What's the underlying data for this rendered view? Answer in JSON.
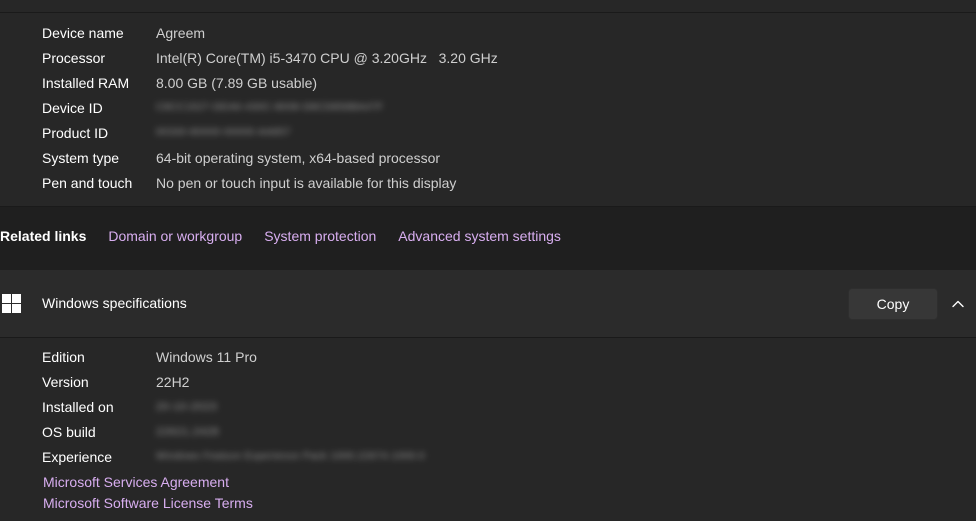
{
  "device_specs": {
    "rows": [
      {
        "key": "Device name",
        "value": "Agreem"
      },
      {
        "key": "Processor",
        "value": "Intel(R) Core(TM) i5-3470 CPU @ 3.20GHz   3.20 GHz"
      },
      {
        "key": "Installed RAM",
        "value": "8.00 GB (7.89 GB usable)"
      },
      {
        "key": "Device ID",
        "value": "C8CC1527-DEA6-430C-8008-D8CD858BA47F"
      },
      {
        "key": "Product ID",
        "value": "00330-80000-00000-AA857"
      },
      {
        "key": "System type",
        "value": "64-bit operating system, x64-based processor"
      },
      {
        "key": "Pen and touch",
        "value": "No pen or touch input is available for this display"
      }
    ]
  },
  "related_links": {
    "label": "Related links",
    "links": [
      "Domain or workgroup",
      "System protection",
      "Advanced system settings"
    ]
  },
  "windows_specs": {
    "title": "Windows specifications",
    "copy_label": "Copy",
    "rows": [
      {
        "key": "Edition",
        "value": "Windows 11 Pro"
      },
      {
        "key": "Version",
        "value": "22H2"
      },
      {
        "key": "Installed on",
        "value": "20-10-2023"
      },
      {
        "key": "OS build",
        "value": "22621.2428"
      },
      {
        "key": "Experience",
        "value": "Windows Feature Experience Pack 1000.22674.1000.0"
      }
    ],
    "links": [
      "Microsoft Services Agreement",
      "Microsoft Software License Terms"
    ]
  },
  "colors": {
    "link": "#d8aef0",
    "panel": "#272727",
    "background": "#1f1f1f"
  }
}
